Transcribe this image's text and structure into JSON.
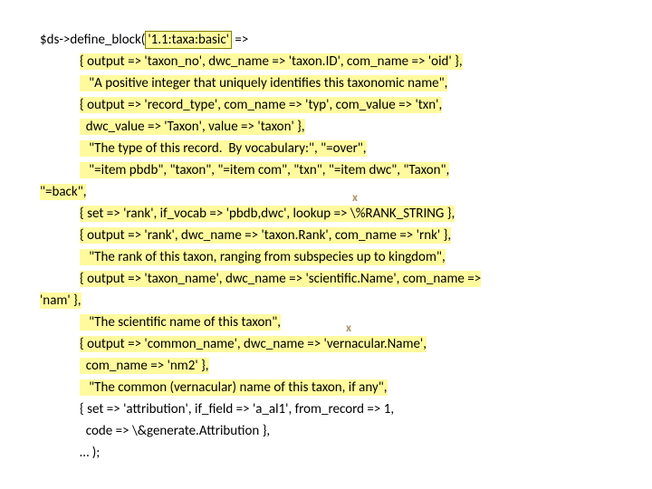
{
  "lines": {
    "l1a": "$ds->define_block(",
    "l1b": "'1.1:taxa:basic'",
    "l1c": " =>",
    "l2": "{ output => 'taxon_no', dwc_name => 'taxon.ID', com_name => 'oid' },",
    "l3": "   \"A positive integer that uniquely identifies this taxonomic name\",",
    "l4": "{ output => 'record_type', com_name => 'typ', com_value => 'txn',",
    "l5": "  dwc_value => 'Taxon', value => 'taxon' },",
    "l6": "   \"The type of this record.  By vocabulary:\", \"=over\",",
    "l7": "   \"=item pbdb\", \"taxon\", \"=item com\", \"txn\", \"=item dwc\", \"Taxon\",",
    "l8": "\"=back\",",
    "l9": "{ set => 'rank', if_vocab => 'pbdb,dwc', lookup => \\%RANK_STRING },",
    "l10": "{ output => 'rank', dwc_name => 'taxon.Rank', com_name => 'rnk' },",
    "l11": "   \"The rank of this taxon, ranging from subspecies up to kingdom\",",
    "l12": "{ output => 'taxon_name', dwc_name => 'scientific.Name', com_name =>",
    "l13": "'nam' },",
    "l14": "   \"The scientific name of this taxon\",",
    "l15": "{ output => 'common_name', dwc_name => 'vernacular.Name',",
    "l16": "  com_name => 'nm2' },",
    "l17": "   \"The common (vernacular) name of this taxon, if any\",",
    "l18": "{ set => 'attribution', if_field => 'a_al1', from_record => 1,",
    "l19": "  code => \\&generate.Attribution },",
    "l20": "… );"
  },
  "marks": {
    "x1": "x",
    "x2": "x"
  }
}
